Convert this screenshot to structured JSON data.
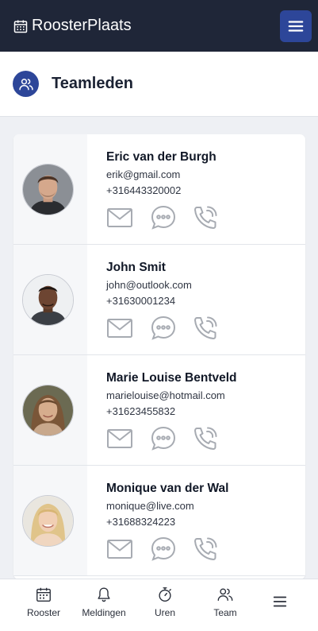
{
  "app": {
    "brand_part1": "Rooster",
    "brand_part2": "Plaats"
  },
  "header": {
    "title": "Teamleden"
  },
  "members": [
    {
      "name": "Eric van der Burgh",
      "email": "erik@gmail.com",
      "phone": "+316443320002"
    },
    {
      "name": "John Smit",
      "email": "john@outlook.com",
      "phone": "+31630001234"
    },
    {
      "name": "Marie Louise Bentveld",
      "email": "marielouise@hotmail.com",
      "phone": "+31623455832"
    },
    {
      "name": "Monique van der Wal",
      "email": "monique@live.com",
      "phone": "+31688324223"
    }
  ],
  "nav": {
    "rooster": "Rooster",
    "meldingen": "Meldingen",
    "uren": "Uren",
    "team": "Team"
  },
  "icons": {
    "brand": "calendar-icon",
    "menu": "hamburger-menu-icon",
    "header": "users-icon",
    "mail": "mail-icon",
    "chat": "chat-bubble-icon",
    "call": "phone-call-icon"
  },
  "colors": {
    "topbar": "#1f2638",
    "accent": "#2d4699",
    "action_icon": "#a7abb2"
  }
}
